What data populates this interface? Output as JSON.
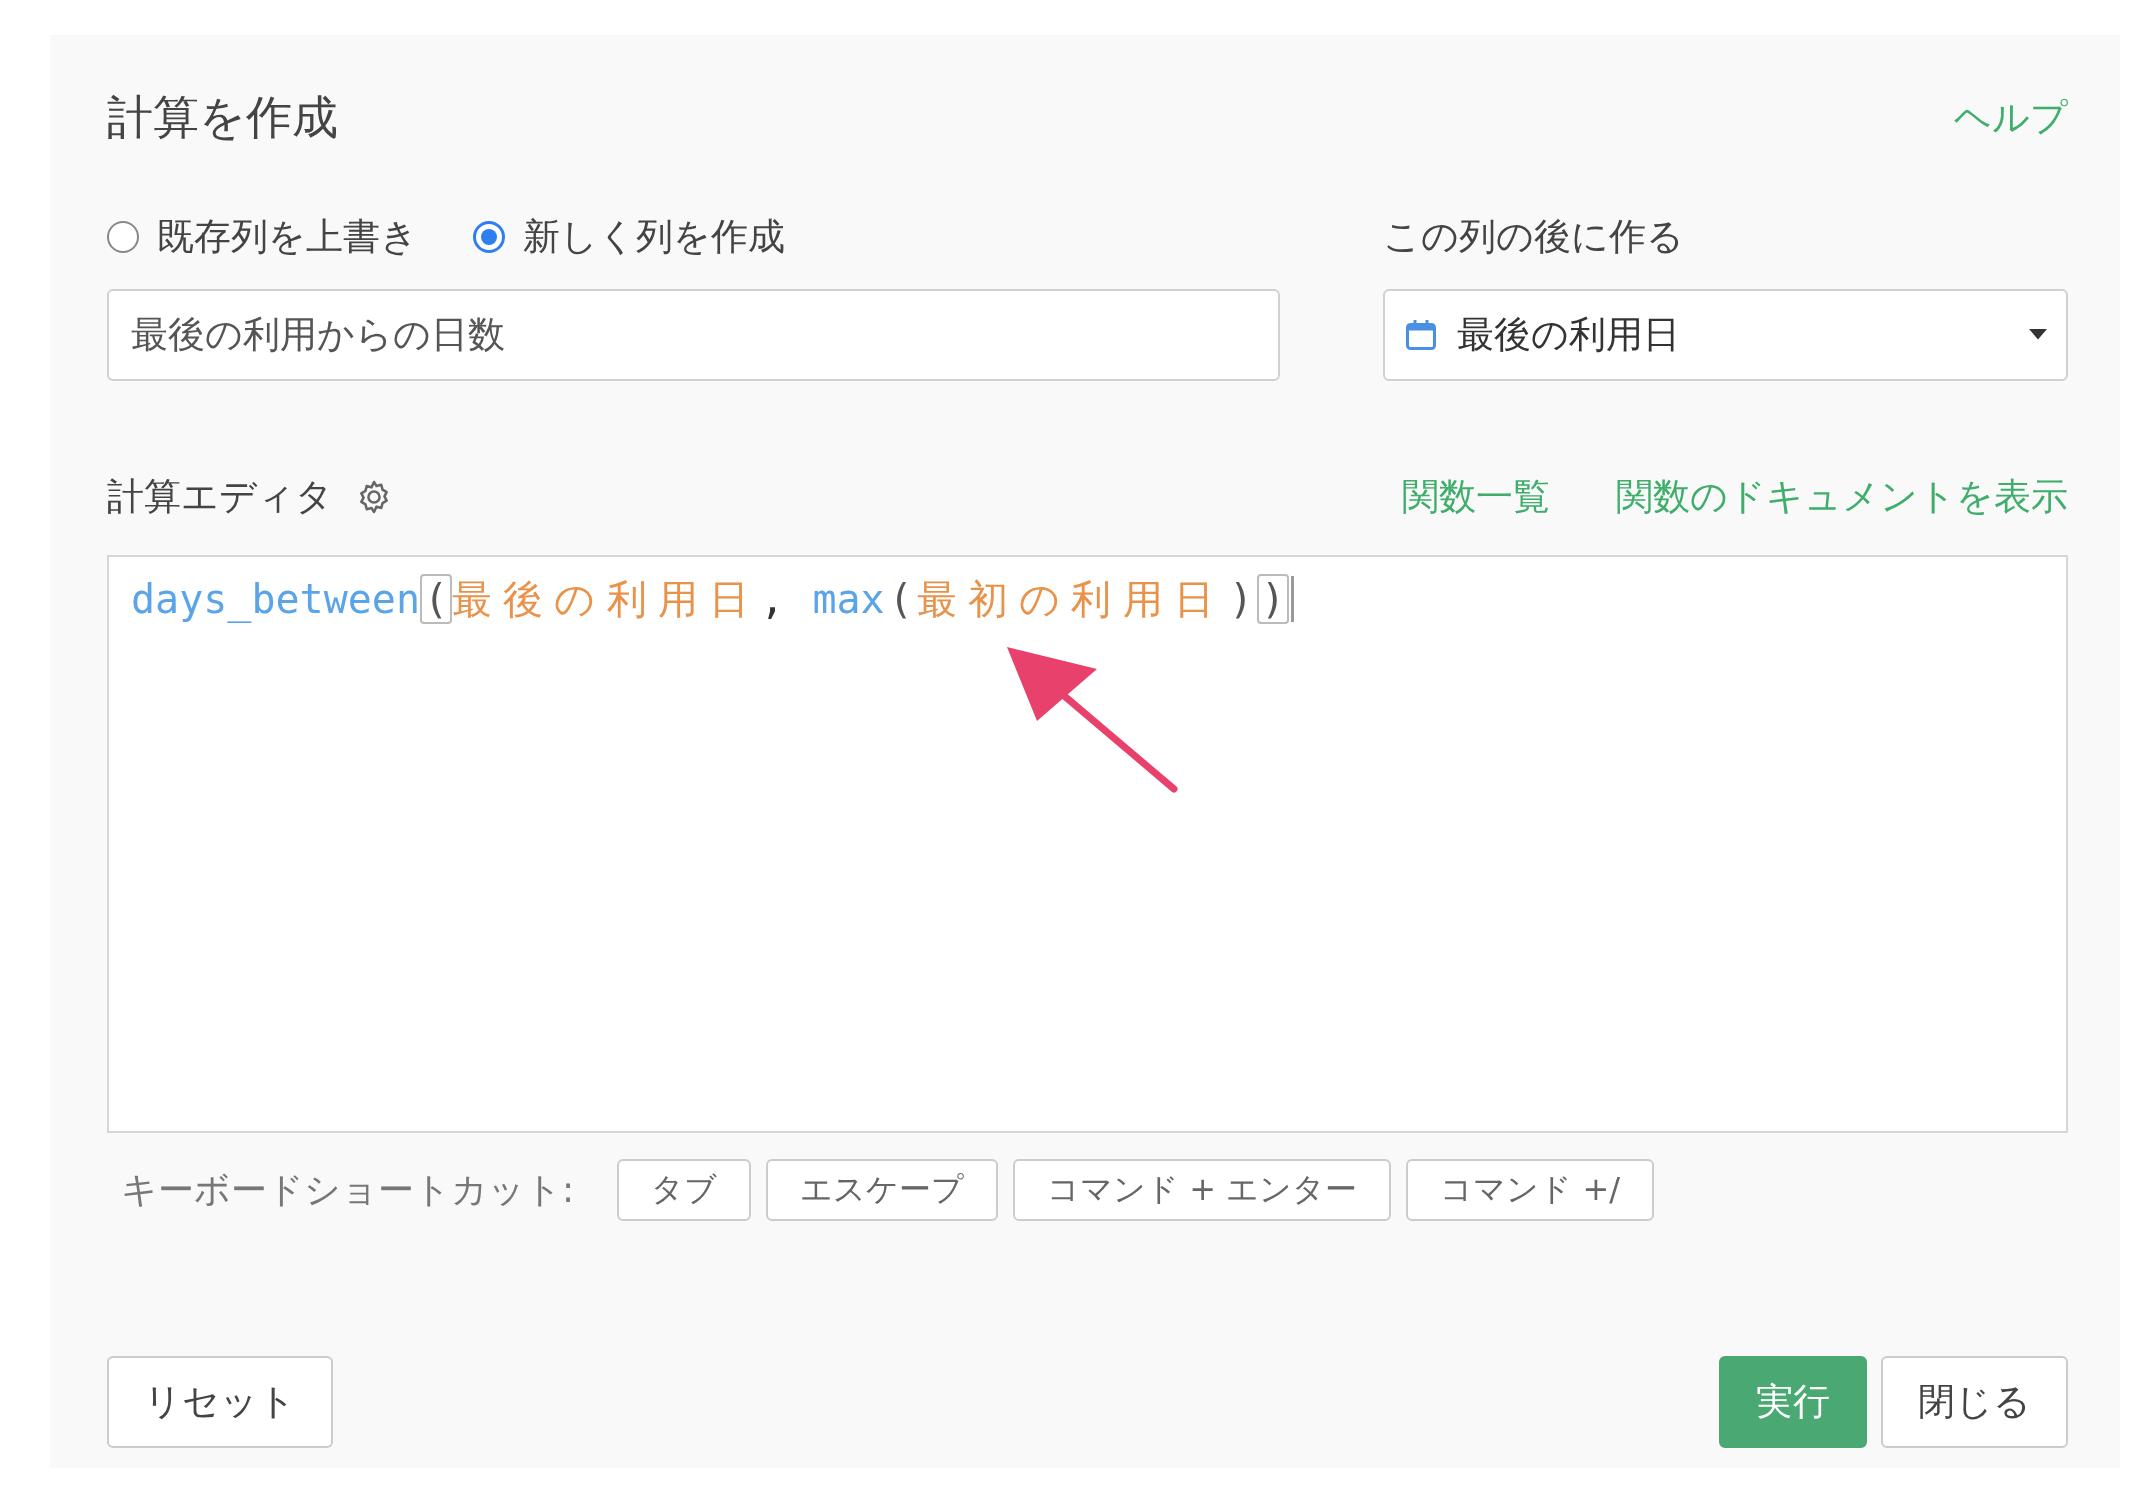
{
  "dialog": {
    "title": "計算を作成",
    "help_link": "ヘルプ"
  },
  "mode_options": [
    {
      "label": "既存列を上書き",
      "selected": false
    },
    {
      "label": "新しく列を作成",
      "selected": true
    }
  ],
  "new_column_name": {
    "value": "最後の利用からの日数"
  },
  "position": {
    "label": "この列の後に作る",
    "value": "最後の利用日"
  },
  "editor": {
    "label": "計算エディタ",
    "links": [
      "関数一覧",
      "関数のドキュメントを表示"
    ],
    "code": [
      {
        "kind": "function",
        "text": "days_between"
      },
      {
        "kind": "paren",
        "text": "(",
        "highlighted": true
      },
      {
        "kind": "column",
        "text": "最後の利用日"
      },
      {
        "kind": "comma",
        "text": ","
      },
      {
        "kind": "function",
        "text": "max"
      },
      {
        "kind": "paren",
        "text": "(",
        "highlighted": false
      },
      {
        "kind": "column",
        "text": "最初の利用日"
      },
      {
        "kind": "paren",
        "text": ")",
        "highlighted": false
      },
      {
        "kind": "paren",
        "text": ")",
        "highlighted": true
      }
    ]
  },
  "shortcuts": {
    "label": "キーボードショートカット:",
    "keys": [
      "タブ",
      "エスケープ",
      "コマンド + エンター",
      "コマンド +/"
    ]
  },
  "buttons": {
    "reset": "リセット",
    "run": "実行",
    "close": "閉じる"
  }
}
